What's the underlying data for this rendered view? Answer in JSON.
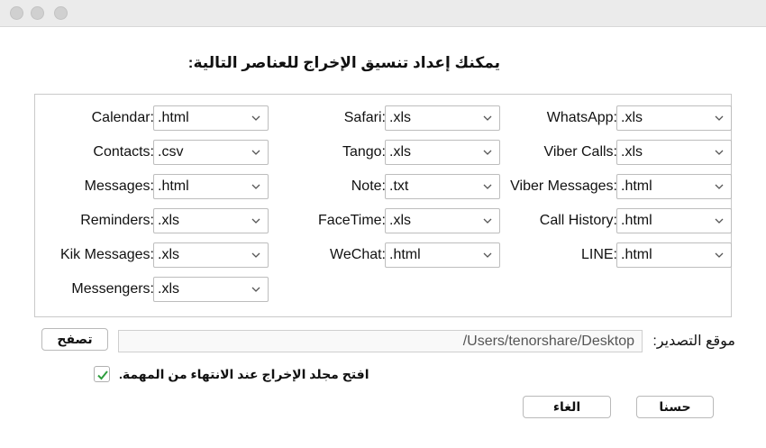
{
  "window": {
    "title": ""
  },
  "heading": "يمكنك إعداد تنسيق الإخراج للعناصر التالية:",
  "formats": {
    "left": [
      {
        "label": "Calendar:",
        "value": ".html"
      },
      {
        "label": "Contacts:",
        "value": ".csv"
      },
      {
        "label": "Messages:",
        "value": ".html"
      },
      {
        "label": "Reminders:",
        "value": ".xls"
      },
      {
        "label": "Kik Messages:",
        "value": ".xls"
      },
      {
        "label": "Messengers:",
        "value": ".xls"
      }
    ],
    "middle": [
      {
        "label": "Safari:",
        "value": ".xls"
      },
      {
        "label": "Tango:",
        "value": ".xls"
      },
      {
        "label": "Note:",
        "value": ".txt"
      },
      {
        "label": "FaceTime:",
        "value": ".xls"
      },
      {
        "label": "WeChat:",
        "value": ".html"
      }
    ],
    "right": [
      {
        "label": "WhatsApp:",
        "value": ".xls"
      },
      {
        "label": "Viber Calls:",
        "value": ".xls"
      },
      {
        "label": "Viber Messages:",
        "value": ".html"
      },
      {
        "label": "Call History:",
        "value": ".html"
      },
      {
        "label": "LINE:",
        "value": ".html"
      }
    ]
  },
  "export": {
    "label": "موقع التصدير:",
    "path": "/Users/tenorshare/Desktop",
    "browse_label": "تصفح"
  },
  "open_folder": {
    "label": "افتح مجلد الإخراج عند الانتهاء من المهمة.",
    "checked": true
  },
  "buttons": {
    "cancel": "الغاء",
    "ok": "حسنا"
  },
  "colors": {
    "check": "#2e9e3e",
    "titlebar": "#ebebeb"
  }
}
